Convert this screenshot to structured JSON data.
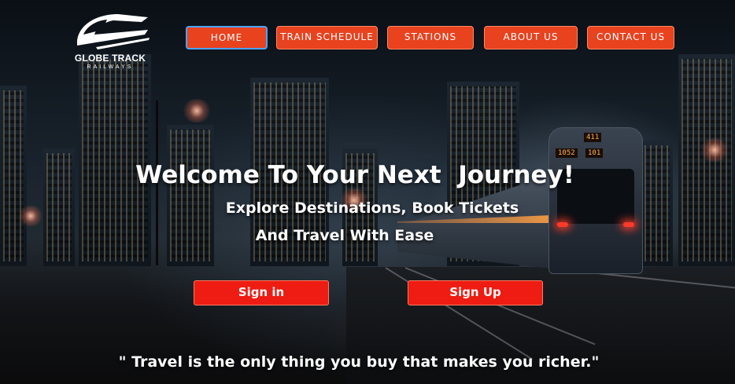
{
  "brand": {
    "name": "GLOBE TRACK",
    "tagline": "RAILWAYS"
  },
  "nav": {
    "items": [
      {
        "label": "HOME",
        "active": true
      },
      {
        "label": "TRAIN SCHEDULE",
        "active": false
      },
      {
        "label": "STATIONS",
        "active": false
      },
      {
        "label": "ABOUT US",
        "active": false
      },
      {
        "label": "CONTACT US",
        "active": false
      }
    ]
  },
  "hero": {
    "headline": "Welcome To Your Next  Journey!",
    "subline_1": "Explore Destinations, Book Tickets",
    "subline_2": "And Travel With Ease",
    "background_image": "night-city-train-photo",
    "train_signs": [
      "411",
      "1052",
      "101"
    ]
  },
  "actions": {
    "sign_in": "Sign in",
    "sign_up": "Sign Up"
  },
  "quote": {
    "text": "\" Travel is the only thing you buy that makes you richer.\""
  },
  "colors": {
    "nav_button": "#e8421f",
    "cta_button": "#ee1c12",
    "active_border": "#4da3ff",
    "text": "#ffffff"
  }
}
